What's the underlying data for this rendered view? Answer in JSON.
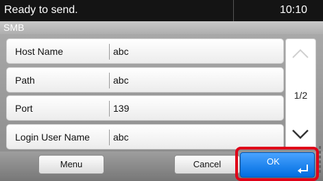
{
  "status": {
    "message": "Ready to send.",
    "time": "10:10"
  },
  "screen": {
    "title": "SMB"
  },
  "fields": [
    {
      "label": "Host Name",
      "value": "abc"
    },
    {
      "label": "Path",
      "value": "abc"
    },
    {
      "label": "Port",
      "value": "139"
    },
    {
      "label": "Login User Name",
      "value": "abc"
    }
  ],
  "pagination": {
    "indicator": "1/2"
  },
  "buttons": {
    "menu": "Menu",
    "cancel": "Cancel",
    "ok": "OK"
  },
  "icons": {
    "scroll_up": "chevron-up-icon",
    "scroll_down": "chevron-down-icon",
    "enter": "enter-icon"
  },
  "colors": {
    "ok_button": "#1a86f5",
    "highlight_frame": "#e00018",
    "status_bar": "#141414"
  }
}
